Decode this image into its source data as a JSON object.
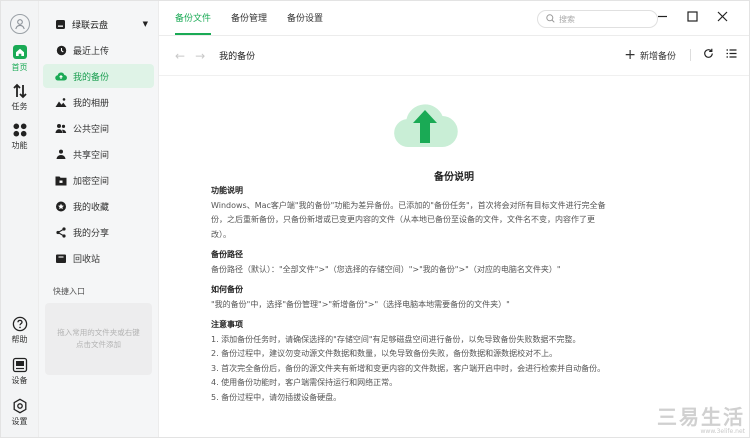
{
  "rail": {
    "items": [
      {
        "label": "首页",
        "icon": "home-icon",
        "active": true
      },
      {
        "label": "任务",
        "icon": "transfer-icon",
        "active": false
      },
      {
        "label": "功能",
        "icon": "apps-icon",
        "active": false
      }
    ],
    "bottom": [
      {
        "label": "帮助",
        "icon": "help-icon"
      },
      {
        "label": "设备",
        "icon": "device-icon"
      },
      {
        "label": "设置",
        "icon": "settings-icon"
      }
    ]
  },
  "sidebar": {
    "account": "绿联云盘",
    "items": [
      {
        "label": "最近上传",
        "icon": "clock-icon"
      },
      {
        "label": "我的备份",
        "icon": "backup-cloud-icon",
        "active": true
      },
      {
        "label": "我的相册",
        "icon": "photo-icon"
      },
      {
        "label": "公共空间",
        "icon": "public-space-icon"
      },
      {
        "label": "共享空间",
        "icon": "shared-space-icon"
      },
      {
        "label": "加密空间",
        "icon": "lock-folder-icon"
      },
      {
        "label": "我的收藏",
        "icon": "star-icon"
      },
      {
        "label": "我的分享",
        "icon": "share-icon"
      },
      {
        "label": "回收站",
        "icon": "trash-icon"
      }
    ],
    "quick_title": "快捷入口",
    "quick_placeholder": "拖入常用的文件夹或右键点击文件添加"
  },
  "topbar": {
    "tabs": [
      {
        "label": "备份文件",
        "active": true
      },
      {
        "label": "备份管理",
        "active": false
      },
      {
        "label": "备份设置",
        "active": false
      }
    ],
    "search_placeholder": "搜索"
  },
  "crumb": {
    "title": "我的备份",
    "add_label": "新增备份"
  },
  "help": {
    "title": "备份说明",
    "sections": [
      {
        "heading": "功能说明",
        "lines": [
          "Windows、Mac客户端\"我的备份\"功能为差异备份。已添加的\"备份任务\"，首次将会对所有目标文件进行完全备份，之后重新备份，只备份新增或已变更内容的文件（从本地已备份至设备的文件，文件名不变，内容作了更改）。"
        ]
      },
      {
        "heading": "备份路径",
        "lines": [
          "备份路径（默认）：\"全部文件\">\"（您选择的存储空间）\">\"我的备份\">\"（对应的电脑名文件夹）\""
        ]
      },
      {
        "heading": "如何备份",
        "lines": [
          "\"我的备份\"中，选择\"备份管理\">\"新增备份\">\"（选择电脑本地需要备份的文件夹）\""
        ]
      },
      {
        "heading": "注意事项",
        "lines": [
          "1. 添加备份任务时，请确保选择的\"存储空间\"有足够磁盘空间进行备份，以免导致备份失败数据不完整。",
          "2. 备份过程中，建议勿变动源文件数据和数量，以免导致备份失败，备份数据和源数据校对不上。",
          "3. 首次完全备份后，备份的源文件夹有新增和变更内容的文件数据，客户端开启中时，会进行检索并自动备份。",
          "4. 使用备份功能时，客户端需保持运行和网络正常。",
          "5. 备份过程中，请勿插拔设备硬盘。"
        ]
      }
    ]
  },
  "watermark": {
    "big": "三易生活",
    "small": "www.3elife.net"
  },
  "colors": {
    "accent": "#1aaa55",
    "cloud": "#c9eed6",
    "arrow": "#1aaa55"
  }
}
